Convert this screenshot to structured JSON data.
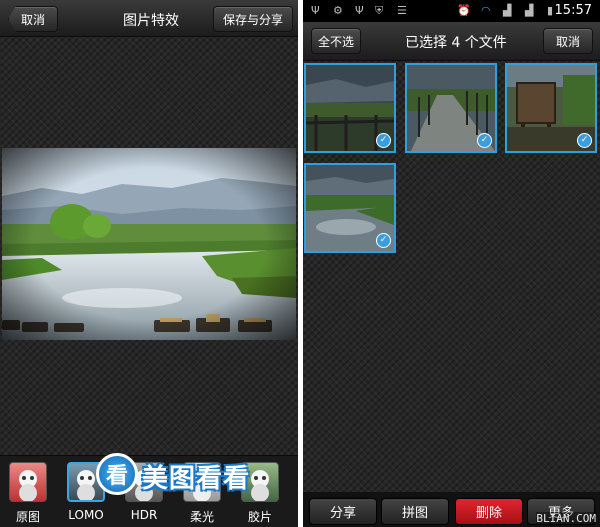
{
  "left": {
    "cancel_label": "取消",
    "title": "图片特效",
    "save_share_label": "保存与分享",
    "effects": [
      {
        "label": "原图",
        "selected": false
      },
      {
        "label": "LOMO",
        "selected": true
      },
      {
        "label": "HDR",
        "selected": false
      },
      {
        "label": "柔光",
        "selected": false
      },
      {
        "label": "胶片",
        "selected": false
      }
    ],
    "logo_glyph": "看",
    "logo_text": "美图看看"
  },
  "right": {
    "status": {
      "icons": [
        "usb-icon",
        "android-debug-icon",
        "usb-icon",
        "shield-icon",
        "storage-icon",
        "alarm-icon",
        "wifi-icon",
        "signal-icon",
        "signal-3g-icon",
        "battery-icon"
      ],
      "time": "15:57"
    },
    "deselect_all_label": "全不选",
    "selection_title": "已选择 4 个文件",
    "cancel_label": "取消",
    "thumbnails": [
      {
        "name": "lake-fence",
        "checked": true
      },
      {
        "name": "boardwalk",
        "checked": true
      },
      {
        "name": "wooden-sign",
        "checked": true
      },
      {
        "name": "lake-reflection",
        "checked": true
      }
    ],
    "actions": {
      "share": "分享",
      "collage": "拼图",
      "delete": "删除",
      "more": "更多"
    },
    "watermark": "BLIAN.COM"
  },
  "colors": {
    "accent": "#2e9fdf",
    "delete_red": "#c8161d"
  }
}
